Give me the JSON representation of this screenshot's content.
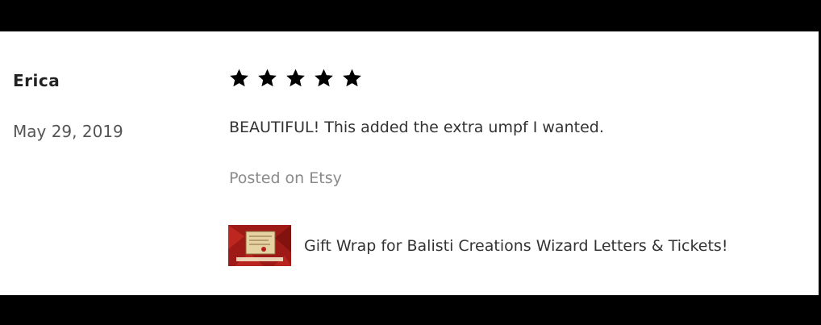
{
  "review": {
    "reviewer_name": "Erica",
    "date": "May 29, 2019",
    "rating": 5,
    "rating_max": 5,
    "text": "BEAUTIFUL! This added the extra umpf I wanted.",
    "posted_on": "Posted on Etsy"
  },
  "product": {
    "title": "Gift Wrap for Balisti Creations Wizard Letters & Tickets!",
    "thumbnail_icon": "gift-wrap-thumbnail"
  },
  "colors": {
    "star": "#000000",
    "bars": "#000000",
    "thumb_red": "#b3201c",
    "thumb_parchment": "#e6d3a3"
  }
}
